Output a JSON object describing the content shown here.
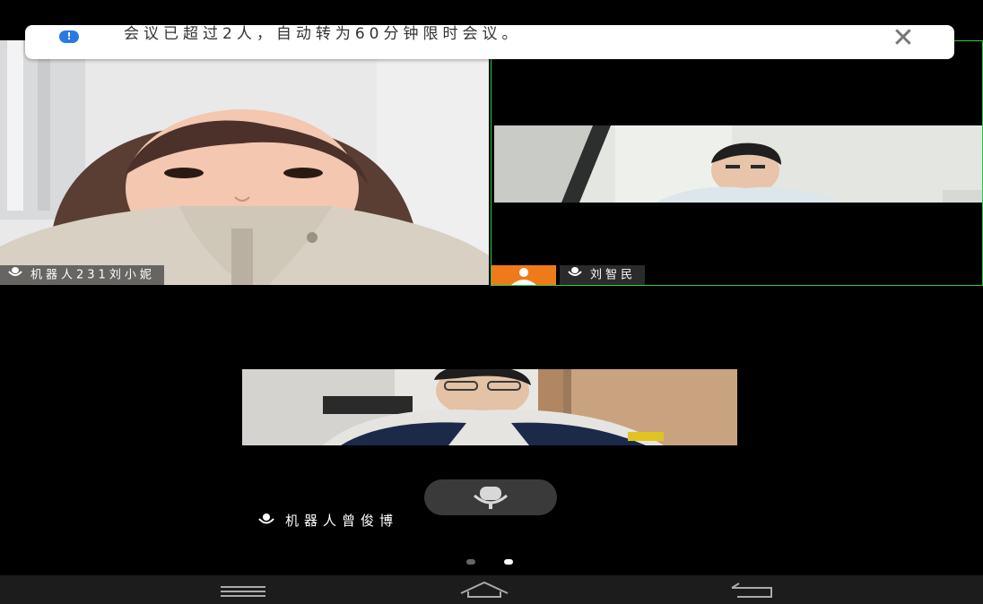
{
  "banner": {
    "message": "会议已超过2人，自动转为60分钟限时会议。",
    "info_glyph": "!",
    "close_glyph": "✕"
  },
  "participants": {
    "left": {
      "name": "机器人231刘小妮"
    },
    "right": {
      "name": "刘智民"
    },
    "bottom": {
      "name": "机器人曾俊博"
    }
  },
  "pager": {
    "active_page": 2,
    "total_pages": 2
  },
  "colors": {
    "active_speaker_border": "#2ecc40",
    "avatar_badge": "#f07a1a",
    "banner_icon": "#2a7ae2"
  },
  "icons": {
    "mute": "microphone-icon",
    "close": "close-icon",
    "info": "info-icon",
    "menu": "menu-icon",
    "home": "home-icon",
    "back": "back-icon",
    "person": "person-icon"
  }
}
